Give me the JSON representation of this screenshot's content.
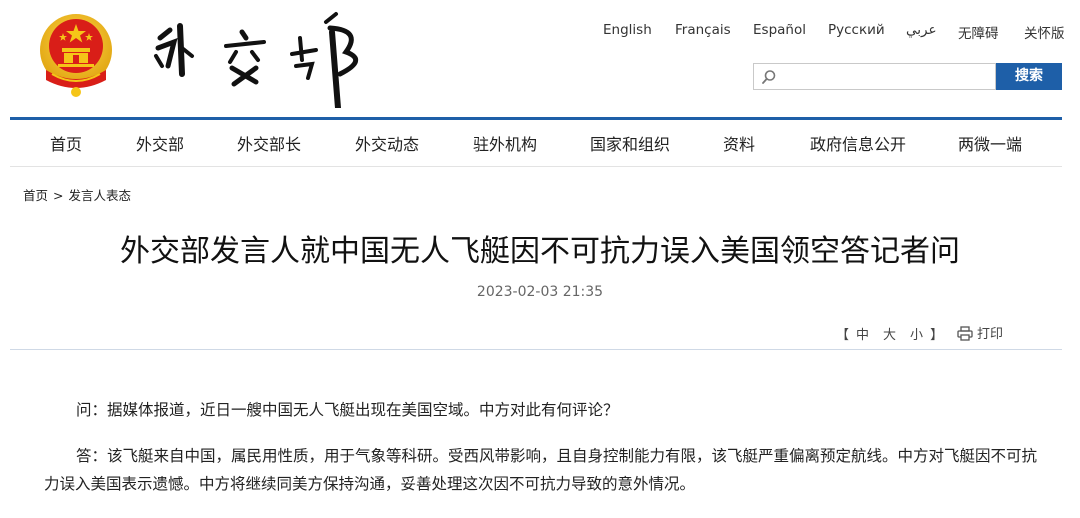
{
  "header": {
    "logo_calligraphy": "外交部",
    "languages": [
      "English",
      "Français",
      "Español",
      "Русский",
      "عربي",
      "无障碍",
      "关怀版"
    ],
    "search": {
      "placeholder": "",
      "button_label": "搜索"
    }
  },
  "nav": {
    "items": [
      "首页",
      "外交部",
      "外交部长",
      "外交动态",
      "驻外机构",
      "国家和组织",
      "资料",
      "政府信息公开",
      "两微一端"
    ]
  },
  "breadcrumb": {
    "items": [
      "首页",
      "发言人表态"
    ],
    "separator": ">"
  },
  "article": {
    "title": "外交部发言人就中国无人飞艇因不可抗力误入美国领空答记者问",
    "date": "2023-02-03 21:35",
    "font_size_controls": {
      "open": "【",
      "options": [
        "中",
        "大",
        "小"
      ],
      "close": "】"
    },
    "print_label": "打印",
    "paragraphs": [
      "问：据媒体报道，近日一艘中国无人飞艇出现在美国空域。中方对此有何评论？",
      "答：该飞艇来自中国，属民用性质，用于气象等科研。受西风带影响，且自身控制能力有限，该飞艇严重偏离预定航线。中方对飞艇因不可抗力误入美国表示遗憾。中方将继续同美方保持沟通，妥善处理这次因不可抗力导致的意外情况。"
    ]
  },
  "colors": {
    "accent": "#1e5fa8",
    "emblem_red": "#d91e18",
    "emblem_gold": "#f5c518"
  },
  "icons": {
    "search": "search-icon",
    "print": "printer-icon",
    "emblem": "national-emblem-icon"
  }
}
